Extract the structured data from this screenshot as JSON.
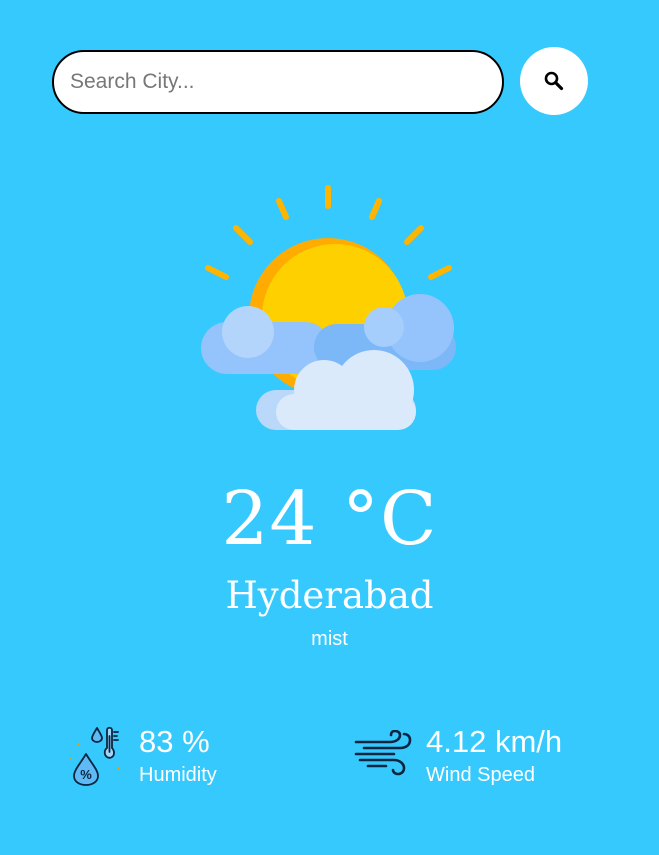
{
  "search": {
    "placeholder": "Search City...",
    "button_icon": "search-icon"
  },
  "weather": {
    "icon": "partly-cloudy-sun-icon",
    "temperature": "24 °C",
    "city": "Hyderabad",
    "description": "mist"
  },
  "details": {
    "humidity": {
      "icon": "humidity-icon",
      "value": "83 %",
      "label": "Humidity"
    },
    "wind": {
      "icon": "wind-icon",
      "value": "4.12 km/h",
      "label": "Wind Speed"
    }
  },
  "colors": {
    "background": "#36c9fe",
    "sun": "#ffd000",
    "sun_shade": "#ffab00",
    "cloud_light": "#dbeafb",
    "cloud_blue": "#94c4fb"
  }
}
